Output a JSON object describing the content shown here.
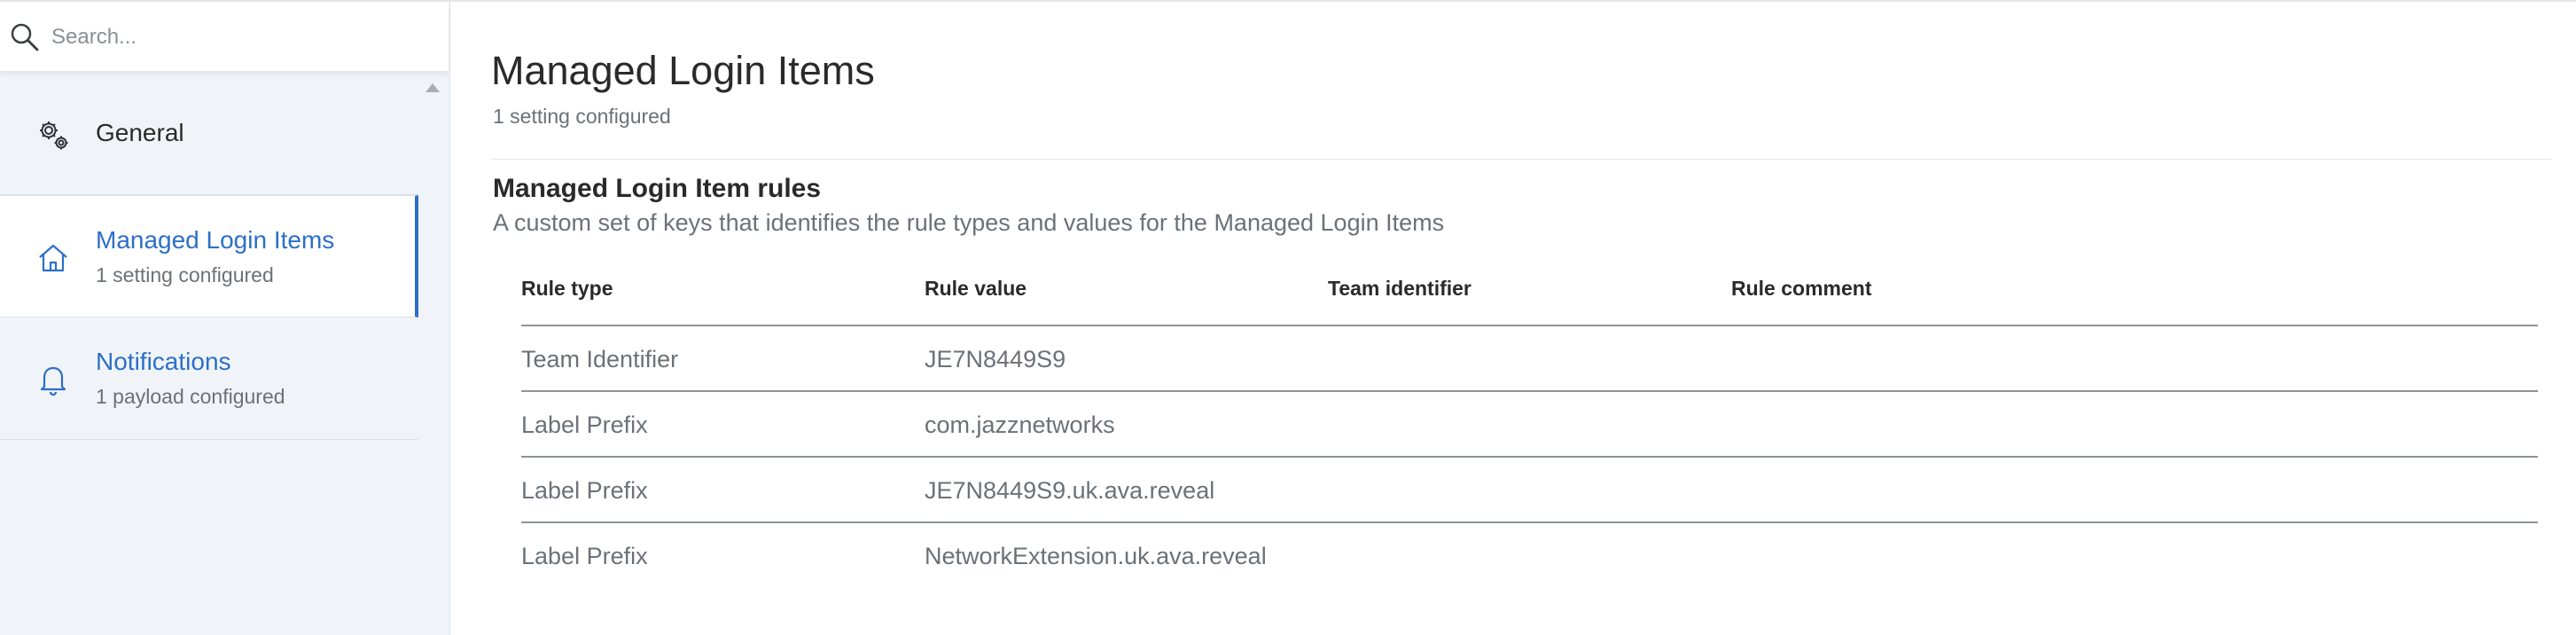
{
  "search": {
    "placeholder": "Search..."
  },
  "sidebar": {
    "items": [
      {
        "title": "General",
        "subtitle": "",
        "icon": "gear-icon",
        "active": false
      },
      {
        "title": "Managed Login Items",
        "subtitle": "1 setting configured",
        "icon": "home-icon",
        "active": true
      },
      {
        "title": "Notifications",
        "subtitle": "1 payload configured",
        "icon": "bell-icon",
        "active": false
      }
    ]
  },
  "main": {
    "title": "Managed Login Items",
    "subtitle": "1 setting configured",
    "section": {
      "title": "Managed Login Item rules",
      "description": "A custom set of keys that identifies the rule types and values for the Managed Login Items"
    },
    "table": {
      "columns": [
        "Rule type",
        "Rule value",
        "Team identifier",
        "Rule comment"
      ],
      "rows": [
        [
          "Team Identifier",
          "JE7N8449S9",
          "",
          ""
        ],
        [
          "Label Prefix",
          "com.jazznetworks",
          "",
          ""
        ],
        [
          "Label Prefix",
          "JE7N8449S9.uk.ava.reveal",
          "",
          ""
        ],
        [
          "Label Prefix",
          "NetworkExtension.uk.ava.reveal",
          "",
          ""
        ]
      ]
    }
  },
  "colors": {
    "accent": "#2c6fc7",
    "sidebar_bg": "#f0f4f8",
    "muted_text": "#6b7177"
  }
}
